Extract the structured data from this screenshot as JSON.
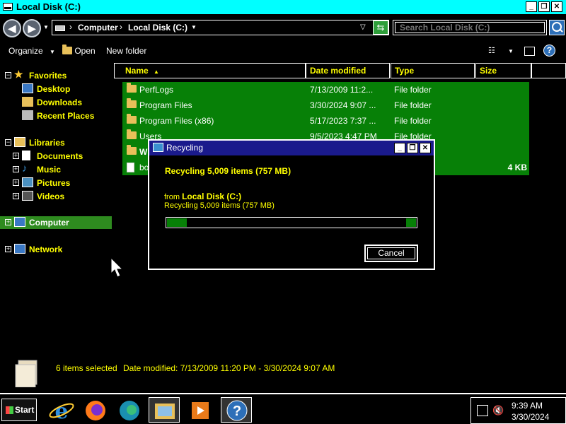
{
  "window": {
    "title": "Local Disk (C:)"
  },
  "address": {
    "crumbs": [
      "Computer",
      "Local Disk (C:)"
    ],
    "search_placeholder": "Search Local Disk (C:)"
  },
  "toolbar": {
    "organize": "Organize",
    "open": "Open",
    "new_folder": "New folder"
  },
  "nav": {
    "favorites": "Favorites",
    "desktop": "Desktop",
    "downloads": "Downloads",
    "recent": "Recent Places",
    "libraries": "Libraries",
    "documents": "Documents",
    "music": "Music",
    "pictures": "Pictures",
    "videos": "Videos",
    "computer": "Computer",
    "network": "Network"
  },
  "columns": {
    "name": "Name",
    "date": "Date modified",
    "type": "Type",
    "size": "Size"
  },
  "files": [
    {
      "name": "PerfLogs",
      "date": "7/13/2009 11:2...",
      "type": "File folder",
      "size": ""
    },
    {
      "name": "Program Files",
      "date": "3/30/2024 9:07 ...",
      "type": "File folder",
      "size": ""
    },
    {
      "name": "Program Files (x86)",
      "date": "5/17/2023 7:37 ...",
      "type": "File folder",
      "size": ""
    },
    {
      "name": "Users",
      "date": "9/5/2023 4:47 PM",
      "type": "File folder",
      "size": ""
    },
    {
      "name": "W",
      "date": "",
      "type": "",
      "size": ""
    },
    {
      "name": "bo",
      "date": "",
      "type": "",
      "size": "4 KB"
    }
  ],
  "dialog": {
    "title": "Recycling",
    "main": "Recycling 5,009 items (757 MB)",
    "from_label": "from",
    "from_location": "Local Disk (C:)",
    "sub": "Recycling 5,009 items (757 MB)",
    "progress": 0.08,
    "cancel": "Cancel"
  },
  "details": {
    "selected": "6 items selected",
    "date_label": "Date modified:",
    "date_range": "7/13/2009 11:20 PM - 3/30/2024 9:07 AM"
  },
  "taskbar": {
    "start": "Start",
    "time": "9:39 AM",
    "date": "3/30/2024"
  }
}
